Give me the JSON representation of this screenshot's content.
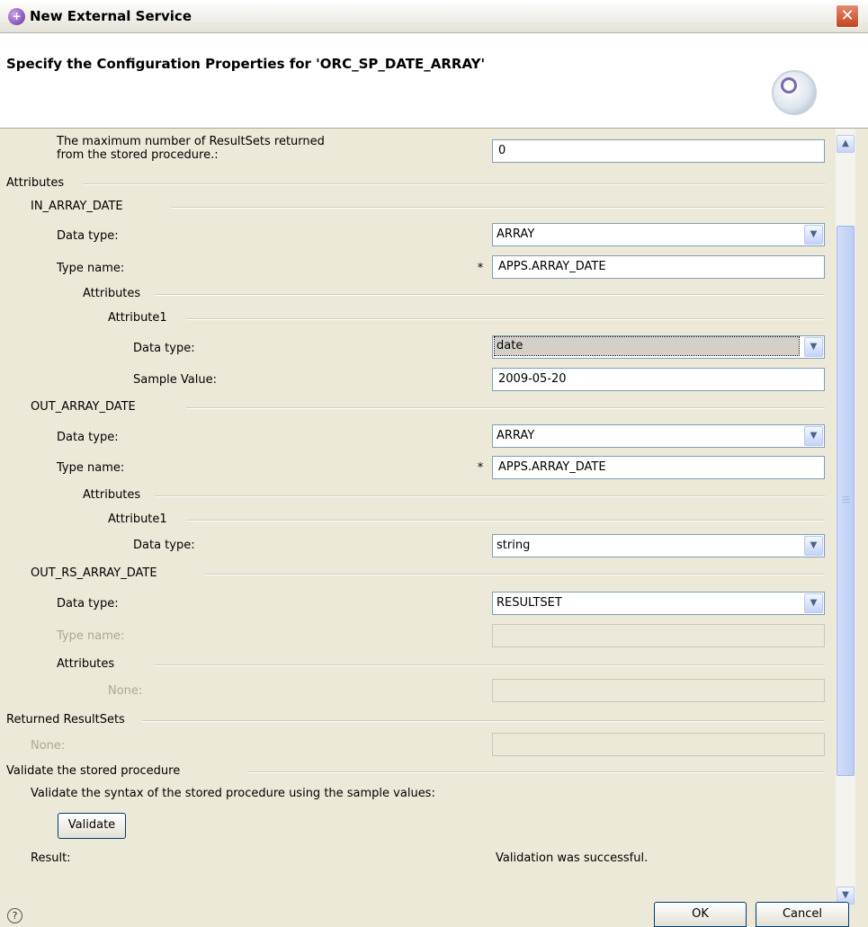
{
  "window": {
    "title": "New External Service",
    "close_label": "✕"
  },
  "header": {
    "title": "Specify the Configuration Properties for 'ORC_SP_DATE_ARRAY'"
  },
  "form": {
    "max_resultsets_label_line1": "The maximum number of ResultSets returned",
    "max_resultsets_label_line2": "from the stored procedure.:",
    "max_resultsets_value": "0",
    "attributes_group": "Attributes",
    "in_array_date": {
      "group": "IN_ARRAY_DATE",
      "data_type_label": "Data type:",
      "data_type_value": "ARRAY",
      "type_name_label": "Type name:",
      "required_mark": "*",
      "type_name_value": "APPS.ARRAY_DATE",
      "attributes_group": "Attributes",
      "attribute1_group": "Attribute1",
      "attr_data_type_label": "Data type:",
      "attr_data_type_value": "date",
      "sample_value_label": "Sample Value:",
      "sample_value": "2009-05-20"
    },
    "out_array_date": {
      "group": "OUT_ARRAY_DATE",
      "data_type_label": "Data type:",
      "data_type_value": "ARRAY",
      "type_name_label": "Type name:",
      "required_mark": "*",
      "type_name_value": "APPS.ARRAY_DATE",
      "attributes_group": "Attributes",
      "attribute1_group": "Attribute1",
      "attr_data_type_label": "Data type:",
      "attr_data_type_value": "string"
    },
    "out_rs_array_date": {
      "group": "OUT_RS_ARRAY_DATE",
      "data_type_label": "Data type:",
      "data_type_value": "RESULTSET",
      "type_name_label": "Type name:",
      "type_name_value": "",
      "attributes_group": "Attributes",
      "none_label": "None:",
      "none_value": ""
    },
    "returned_resultsets": {
      "group": "Returned ResultSets",
      "none_label": "None:",
      "none_value": ""
    },
    "validate": {
      "group": "Validate the stored procedure",
      "description": "Validate the syntax of the stored procedure using the sample values:",
      "button": "Validate",
      "result_label": "Result:",
      "result_value": "Validation was successful."
    }
  },
  "footer": {
    "ok": "OK",
    "cancel": "Cancel",
    "help": "?"
  },
  "colors": {
    "titlebar": "#ece9d8",
    "close": "#c4441e",
    "field_border": "#7f9db9"
  }
}
